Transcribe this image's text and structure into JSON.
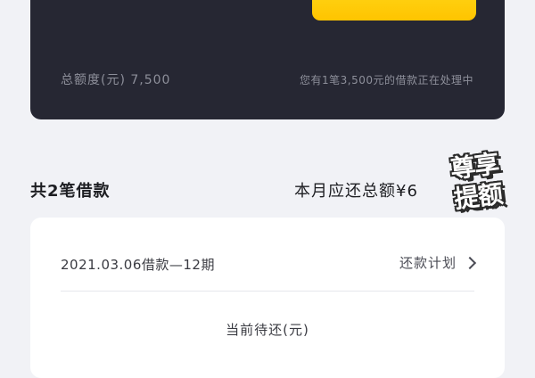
{
  "card": {
    "total_quota": "总额度(元) 7,500",
    "processing_note": "您有1笔3,500元的借款正在处理中"
  },
  "summary": {
    "loan_count": "共2笔借款",
    "monthly_due": "本月应还总额¥6"
  },
  "watermark": {
    "line1": "尊享",
    "line2": "提额"
  },
  "loan": {
    "title": "2021.03.06借款—12期",
    "plan_link": "还款计划",
    "pending_label": "当前待还(元)"
  },
  "colors": {
    "card_background": "#262733",
    "accent_yellow": "#ffc400",
    "page_background": "#f1f2f6"
  }
}
